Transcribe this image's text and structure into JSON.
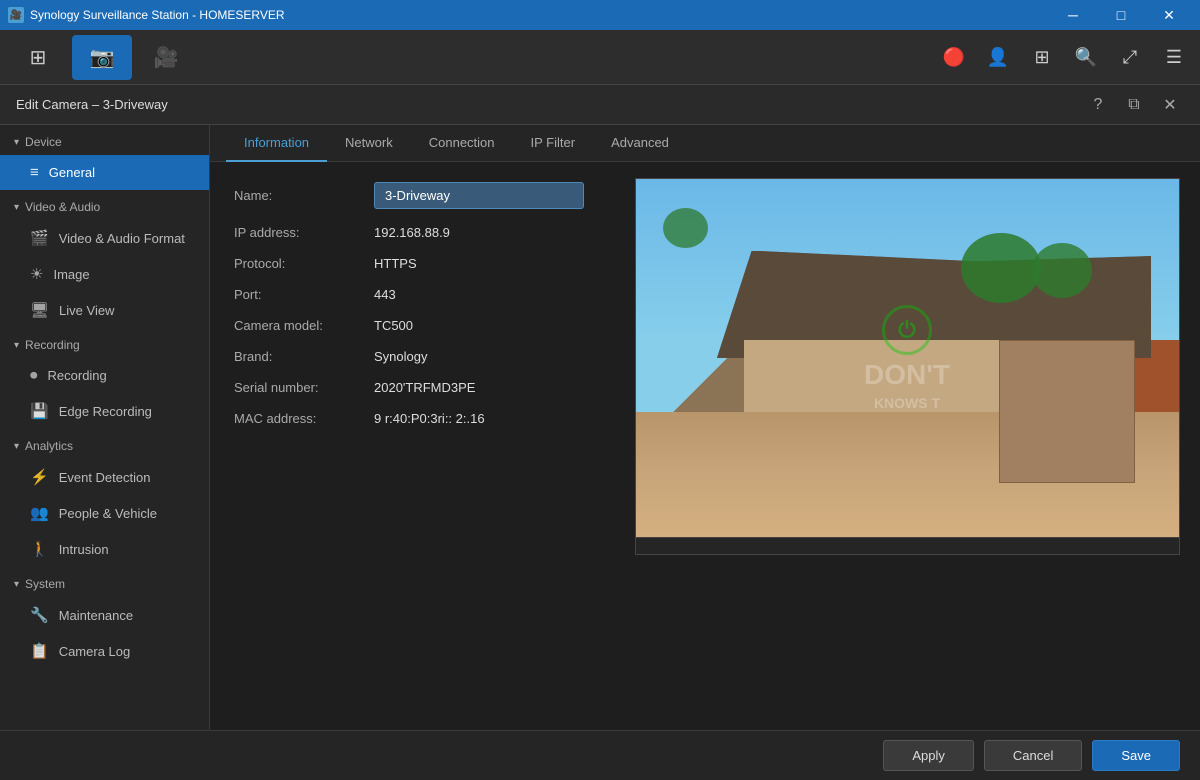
{
  "titlebar": {
    "title": "Synology Surveillance Station - HOMESERVER",
    "icon": "🎥",
    "controls": {
      "minimize": "─",
      "maximize": "□",
      "close": "✕"
    }
  },
  "toolbar": {
    "buttons": [
      {
        "id": "overview",
        "icon": "⊞",
        "label": "",
        "active": false
      },
      {
        "id": "camera",
        "icon": "📷",
        "label": "",
        "active": true
      },
      {
        "id": "fisheye",
        "icon": "🎥",
        "label": "",
        "active": false
      }
    ],
    "actions": [
      {
        "id": "profile",
        "icon": "👤"
      },
      {
        "id": "account",
        "icon": "👤"
      },
      {
        "id": "layout",
        "icon": "⊞"
      },
      {
        "id": "search",
        "icon": "🔍"
      },
      {
        "id": "fullscreen",
        "icon": "⤢"
      },
      {
        "id": "menu",
        "icon": "☰"
      }
    ]
  },
  "edit_header": {
    "title": "Edit Camera – 3-Driveway",
    "help_icon": "?",
    "restore_icon": "⧉",
    "close_icon": "✕"
  },
  "sidebar": {
    "sections": [
      {
        "id": "device",
        "label": "Device",
        "items": [
          {
            "id": "general",
            "icon": "≡",
            "label": "General",
            "active": true
          }
        ]
      },
      {
        "id": "video-audio",
        "label": "Video & Audio",
        "items": [
          {
            "id": "video-audio-format",
            "icon": "🎬",
            "label": "Video & Audio Format"
          },
          {
            "id": "image",
            "icon": "☀",
            "label": "Image"
          },
          {
            "id": "live-view",
            "icon": "🖥",
            "label": "Live View"
          }
        ]
      },
      {
        "id": "recording",
        "label": "Recording",
        "items": [
          {
            "id": "recording",
            "icon": "⏺",
            "label": "Recording"
          },
          {
            "id": "edge-recording",
            "icon": "💾",
            "label": "Edge Recording"
          }
        ]
      },
      {
        "id": "analytics",
        "label": "Analytics",
        "items": [
          {
            "id": "event-detection",
            "icon": "⚡",
            "label": "Event Detection"
          },
          {
            "id": "people-vehicle",
            "icon": "👥",
            "label": "People & Vehicle"
          },
          {
            "id": "intrusion",
            "icon": "🚶",
            "label": "Intrusion"
          }
        ]
      },
      {
        "id": "system",
        "label": "System",
        "items": [
          {
            "id": "maintenance",
            "icon": "🔧",
            "label": "Maintenance"
          },
          {
            "id": "camera-log",
            "icon": "📋",
            "label": "Camera Log"
          }
        ]
      }
    ]
  },
  "tabs": {
    "items": [
      {
        "id": "information",
        "label": "Information",
        "active": true
      },
      {
        "id": "network",
        "label": "Network",
        "active": false
      },
      {
        "id": "connection",
        "label": "Connection",
        "active": false
      },
      {
        "id": "ip-filter",
        "label": "IP Filter",
        "active": false
      },
      {
        "id": "advanced",
        "label": "Advanced",
        "active": false
      }
    ]
  },
  "form": {
    "fields": [
      {
        "id": "name",
        "label": "Name:",
        "value": "3-Driveway",
        "editable": true
      },
      {
        "id": "ip-address",
        "label": "IP address:",
        "value": "192.168.88.9",
        "editable": false
      },
      {
        "id": "protocol",
        "label": "Protocol:",
        "value": "HTTPS",
        "editable": false
      },
      {
        "id": "port",
        "label": "Port:",
        "value": "443",
        "editable": false
      },
      {
        "id": "camera-model",
        "label": "Camera model:",
        "value": "TC500",
        "editable": false
      },
      {
        "id": "brand",
        "label": "Brand:",
        "value": "Synology",
        "editable": false
      },
      {
        "id": "serial-number",
        "label": "Serial number:",
        "value": "2020'TRFMD3PE",
        "editable": false
      },
      {
        "id": "mac-address",
        "label": "MAC address:",
        "value": "9 r:40:P0:3ri:: 2:.16",
        "editable": false
      }
    ]
  },
  "watermark": {
    "icon": "⏻",
    "line1": "DON'T",
    "line2": "KNOWS T"
  },
  "bottom_bar": {
    "apply_label": "Apply",
    "cancel_label": "Cancel",
    "save_label": "Save"
  }
}
